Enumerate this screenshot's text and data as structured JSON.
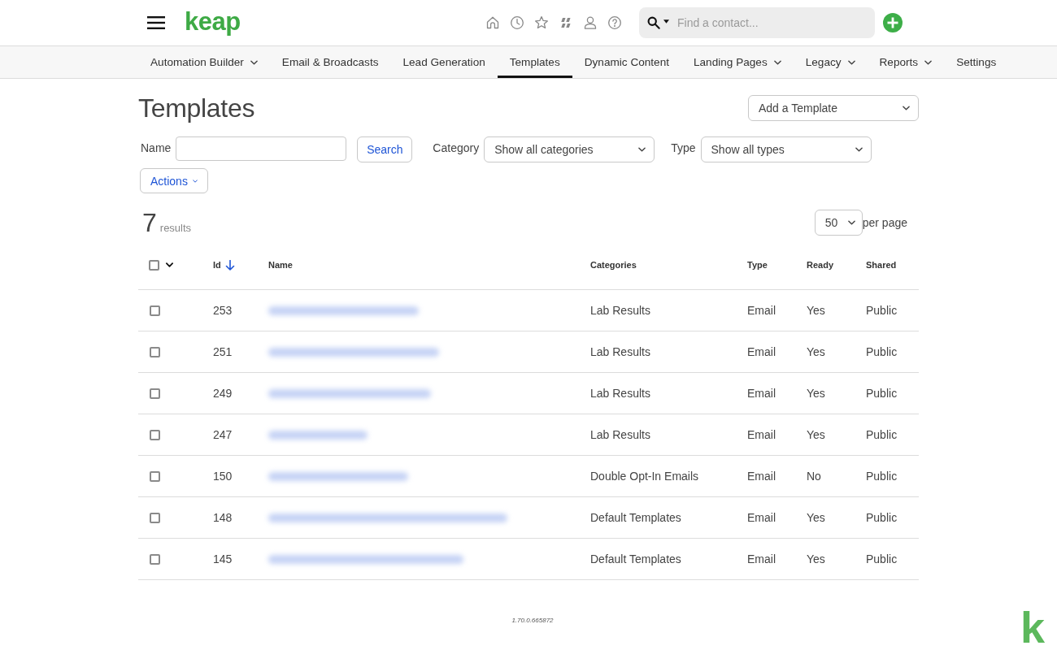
{
  "header": {
    "logo": "keap",
    "search": {
      "placeholder": "Find a contact..."
    }
  },
  "nav": [
    {
      "label": "Automation Builder",
      "has_menu": true,
      "selected": false
    },
    {
      "label": "Email & Broadcasts",
      "has_menu": false,
      "selected": false
    },
    {
      "label": "Lead Generation",
      "has_menu": false,
      "selected": false
    },
    {
      "label": "Templates",
      "has_menu": false,
      "selected": true
    },
    {
      "label": "Dynamic Content",
      "has_menu": false,
      "selected": false
    },
    {
      "label": "Landing Pages",
      "has_menu": true,
      "selected": false
    },
    {
      "label": "Legacy",
      "has_menu": true,
      "selected": false
    },
    {
      "label": "Reports",
      "has_menu": true,
      "selected": false
    },
    {
      "label": "Settings",
      "has_menu": false,
      "selected": false
    }
  ],
  "page": {
    "title": "Templates",
    "add_select": "Add a Template"
  },
  "filters": {
    "name_label": "Name",
    "search_button": "Search",
    "category_label": "Category",
    "category_value": "Show all categories",
    "type_label": "Type",
    "type_value": "Show all types",
    "actions_button": "Actions"
  },
  "results": {
    "count": "7",
    "label": "results",
    "per_page_value": "50",
    "per_page_label": "per page"
  },
  "table": {
    "select_all_checked": false,
    "columns": [
      {
        "label": "Id",
        "sorted": true
      },
      {
        "label": "Name",
        "sorted": false
      },
      {
        "label": "Categories",
        "sorted": false
      },
      {
        "label": "Type",
        "sorted": false
      },
      {
        "label": "Ready",
        "sorted": false
      },
      {
        "label": "Shared",
        "sorted": false
      }
    ],
    "rows": [
      {
        "checked": false,
        "id": "253",
        "category": "Lab Results",
        "type": "Email",
        "ready": "Yes",
        "shared": "Public"
      },
      {
        "checked": false,
        "id": "251",
        "category": "Lab Results",
        "type": "Email",
        "ready": "Yes",
        "shared": "Public"
      },
      {
        "checked": false,
        "id": "249",
        "category": "Lab Results",
        "type": "Email",
        "ready": "Yes",
        "shared": "Public"
      },
      {
        "checked": false,
        "id": "247",
        "category": "Lab Results",
        "type": "Email",
        "ready": "Yes",
        "shared": "Public"
      },
      {
        "checked": false,
        "id": "150",
        "category": "Double Opt-In Emails",
        "type": "Email",
        "ready": "No",
        "shared": "Public"
      },
      {
        "checked": false,
        "id": "148",
        "category": "Default Templates",
        "type": "Email",
        "ready": "Yes",
        "shared": "Public"
      },
      {
        "checked": false,
        "id": "145",
        "category": "Default Templates",
        "type": "Email",
        "ready": "Yes",
        "shared": "Public"
      }
    ]
  },
  "footer": {
    "version": "1.70.0.665872"
  },
  "corner_logo": "k"
}
